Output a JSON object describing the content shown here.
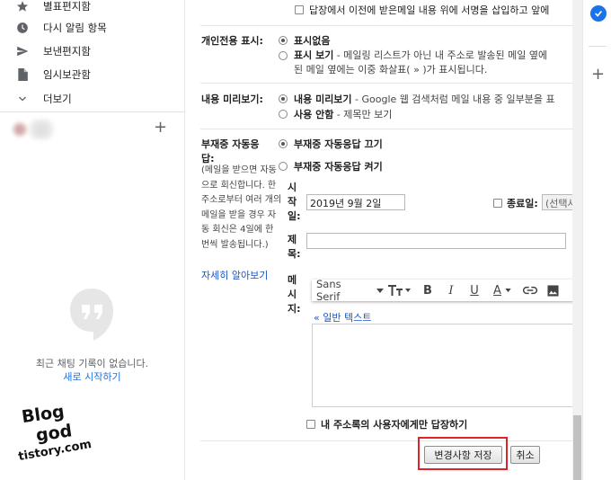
{
  "sidebar": {
    "items": [
      {
        "icon": "star-icon",
        "label": "별표편지함"
      },
      {
        "icon": "clock-icon",
        "label": "다시 알림 항목"
      },
      {
        "icon": "send-icon",
        "label": "보낸편지함"
      },
      {
        "icon": "file-icon",
        "label": "임시보관함"
      },
      {
        "icon": "chevron-down-icon",
        "label": "더보기"
      }
    ],
    "add_label": "+",
    "chat_empty": "최근 채팅 기록이 없습니다.",
    "chat_start": "새로 시작하기"
  },
  "watermark": {
    "line1": "Blog",
    "line2": "god",
    "line3": "tistory.com"
  },
  "signature": {
    "checkbox_text": "답장에서 이전에 받은메일 내용 위에 서명을 삽입하고 앞에"
  },
  "personal_indicators": {
    "label": "개인전용 표시:",
    "option1": "표시없음",
    "option2_bold": "표시 보기",
    "option2_desc": " - 메일링 리스트가 아닌 내 주소로 발송된 메일 옆에",
    "option2_desc2": "된 메일 옆에는 이중 화살표( » )가 표시됩니다."
  },
  "snippets": {
    "label": "내용 미리보기:",
    "option1_bold": "내용 미리보기",
    "option1_desc": " - Google 웹 검색처럼 메일 내용 중 일부분을 표",
    "option2_bold": "사용 안함",
    "option2_desc": " - 제목만 보기"
  },
  "vacation": {
    "label_line1": "부재중 자동응",
    "label_line2": "답:",
    "note": "(메일을 받으면 자동으로 회신합니다. 한 주소로부터 여러 개의 메일을 받을 경우 자동 회신은 4일에 한 번씩 발송됩니다.)",
    "learn_more": "자세히 알아보기",
    "off_option": "부재중 자동응답 끄기",
    "on_option": "부재중 자동응답 켜기",
    "start_label": [
      "시",
      "작",
      "일:"
    ],
    "start_value": "2019년 9월 2일",
    "end_label": "종료일:",
    "end_value": "(선택사항)",
    "subject_label": [
      "제",
      "목:"
    ],
    "subject_value": "",
    "message_label": [
      "메",
      "시",
      "지:"
    ],
    "font_name": "Sans Serif",
    "plain_text_link": "« 일반 텍스트",
    "contacts_only": "내 주소록의 사용자에게만 답장하기"
  },
  "actions": {
    "save": "변경사항 저장",
    "cancel": "취소"
  },
  "colors": {
    "highlight": "#e0232b",
    "link": "#1a54c7",
    "tasks": "#1a73e8"
  }
}
